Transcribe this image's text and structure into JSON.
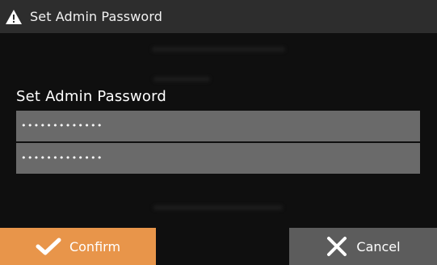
{
  "dialog": {
    "title": "Set Admin Password",
    "title_icon": "warning-icon"
  },
  "form": {
    "section_label": "Set Admin Password",
    "password": "•••••••••••••",
    "confirm_password": "•••••••••••••"
  },
  "footer": {
    "confirm_label": "Confirm",
    "confirm_icon": "checkmark-icon",
    "cancel_label": "Cancel",
    "cancel_icon": "close-icon"
  },
  "colors": {
    "title_bar": "#2d2d2d",
    "field_bg": "#6a6a6a",
    "confirm_bg": "#e8954a",
    "cancel_bg": "#5c5c5c"
  }
}
